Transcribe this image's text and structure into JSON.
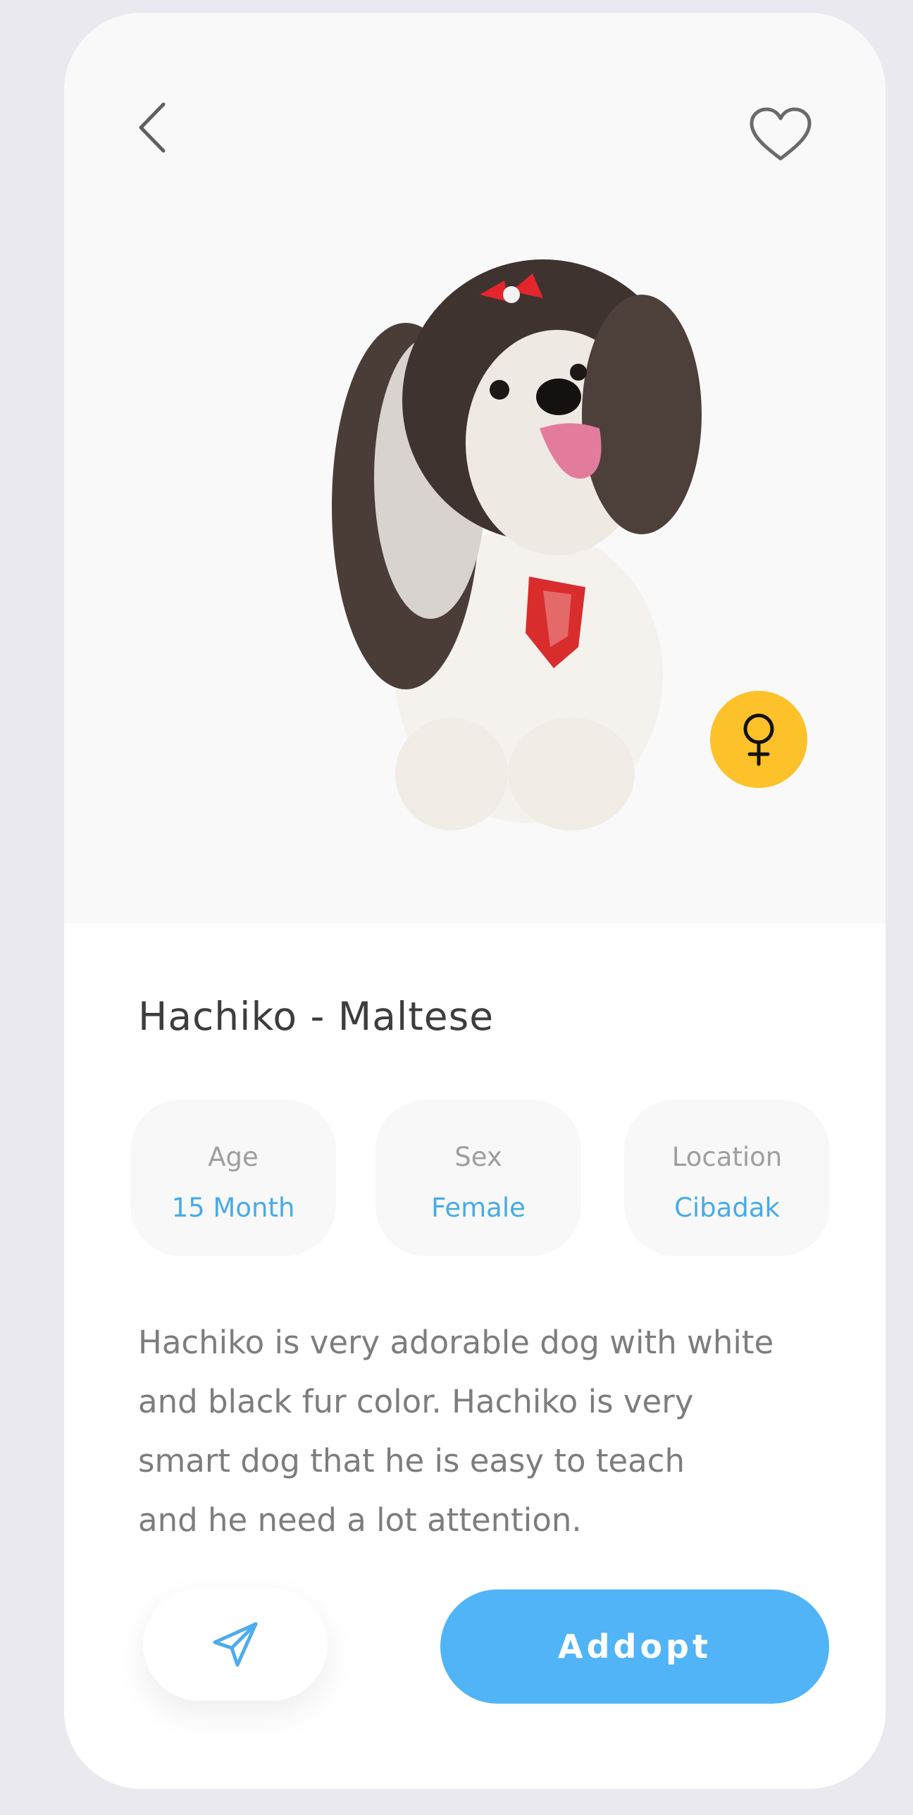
{
  "header": {
    "back_icon": "chevron-left-icon",
    "favorite_icon": "heart-outline-icon"
  },
  "pet": {
    "name": "Hachiko - Maltese",
    "image": "white-and-black-maltese-dog-photo",
    "gender_icon": "female-symbol-icon",
    "gender_badge_color": "#FDC12A"
  },
  "stats": [
    {
      "label": "Age",
      "value": "15 Month"
    },
    {
      "label": "Sex",
      "value": "Female"
    },
    {
      "label": "Location",
      "value": "Cibadak"
    }
  ],
  "description_lines": [
    "Hachiko is very adorable dog with white",
    "and black fur color. Hachiko is very",
    "smart dog that he is easy to teach",
    "and he need a lot attention."
  ],
  "actions": {
    "send_icon": "paper-plane-icon",
    "adopt_label": "Addopt"
  },
  "colors": {
    "accent": "#50B4F7",
    "value_text": "#47ABE6",
    "badge": "#FDC12A"
  }
}
